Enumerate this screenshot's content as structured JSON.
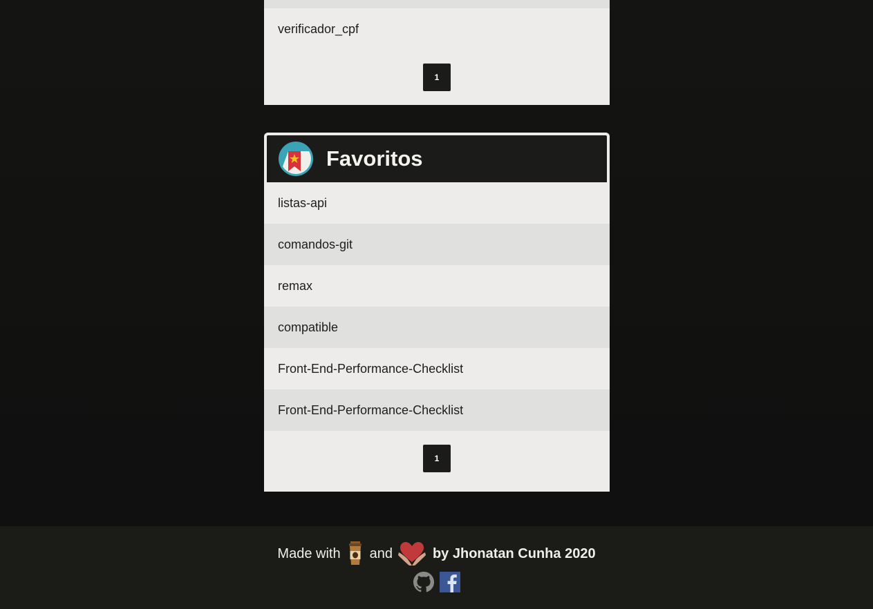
{
  "top_list": {
    "items": [
      "verificador_cpf"
    ],
    "pagination": {
      "pages": [
        "1"
      ]
    }
  },
  "favorites": {
    "title": "Favoritos",
    "items": [
      "listas-api",
      "comandos-git",
      "remax",
      "compatible",
      "Front-End-Performance-Checklist",
      "Front-End-Performance-Checklist"
    ],
    "pagination": {
      "pages": [
        "1"
      ]
    }
  },
  "footer": {
    "made_with": "Made with",
    "and": "and",
    "author": "by Jhonatan Cunha 2020",
    "icons": [
      "coffee-cup-icon",
      "heart-hands-icon",
      "github-icon",
      "facebook-icon"
    ]
  },
  "colors": {
    "page_background": "#121211",
    "panel_background": "#edecea",
    "row_alt_background": "#e0e0df",
    "header_background": "#1b1c19",
    "footer_background": "#1b1c18",
    "page_button": "#1b1b19"
  }
}
